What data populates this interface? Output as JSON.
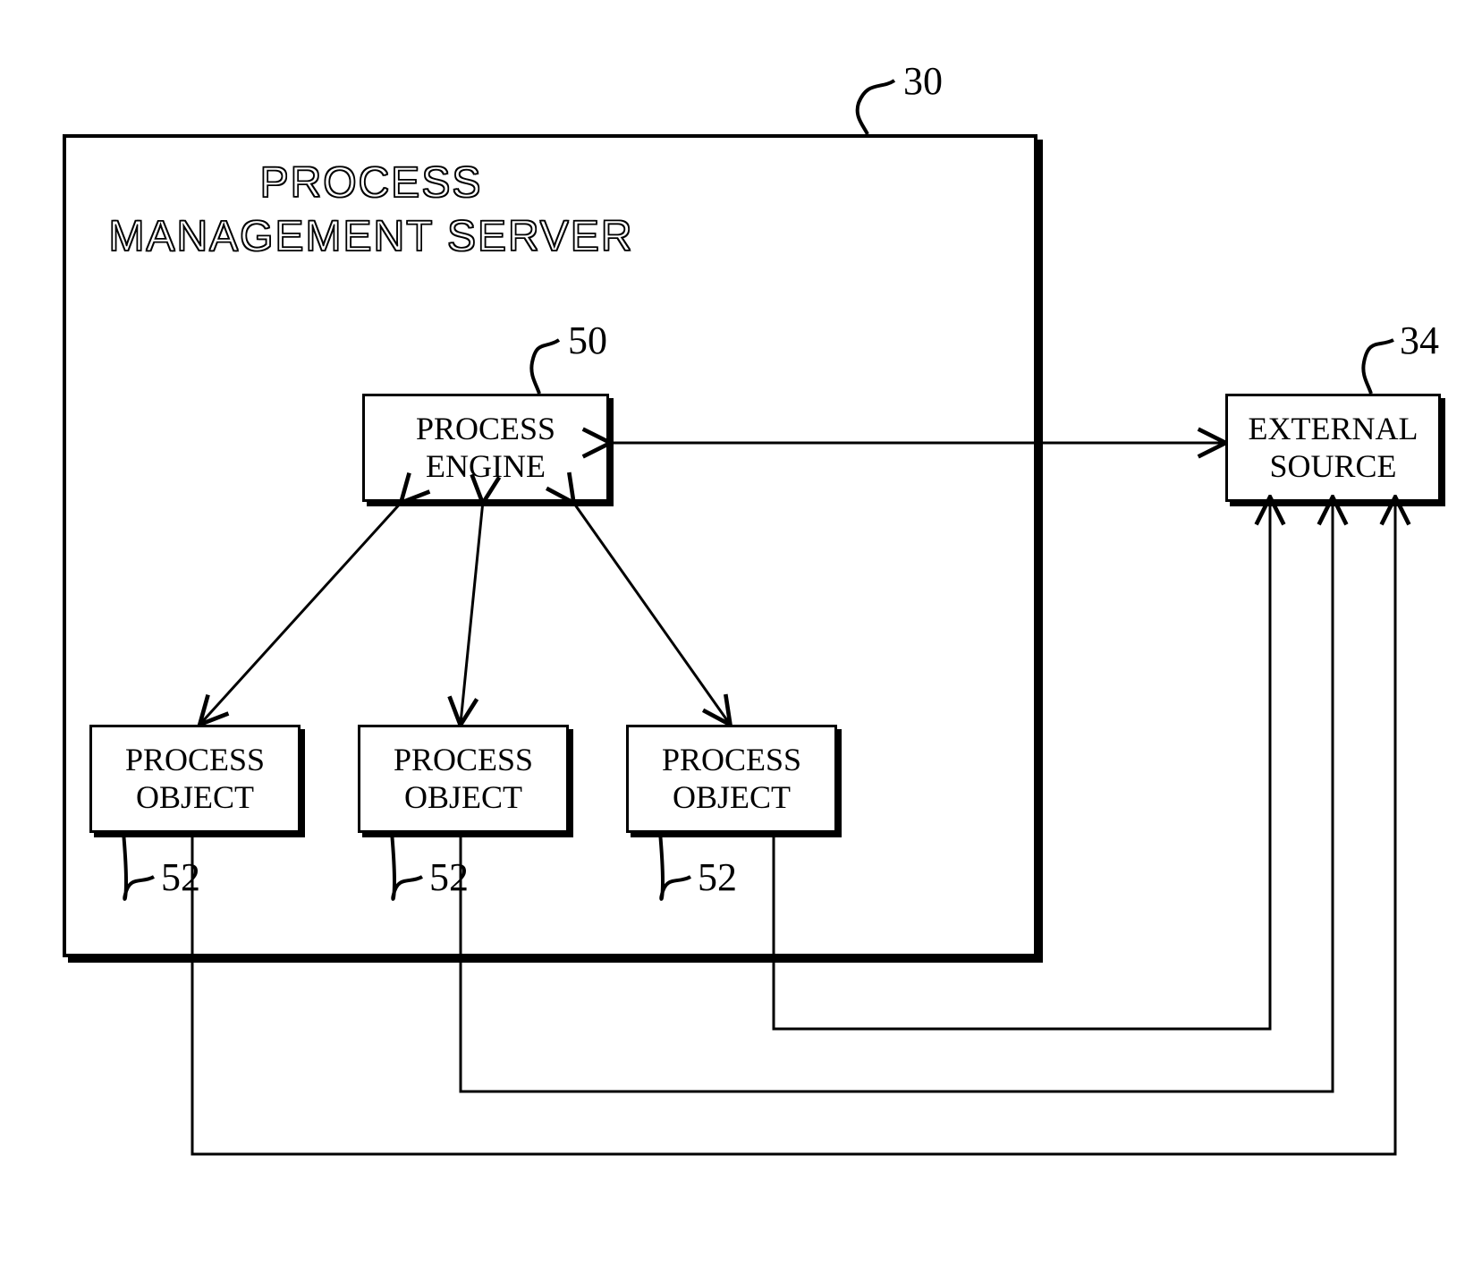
{
  "server": {
    "title": "PROCESS MANAGEMENT\nSERVER",
    "ref": "30"
  },
  "engine": {
    "label": "PROCESS\nENGINE",
    "ref": "50"
  },
  "objects": {
    "label": "PROCESS\nOBJECT",
    "ref": "52"
  },
  "external": {
    "label": "EXTERNAL\nSOURCE",
    "ref": "34"
  }
}
